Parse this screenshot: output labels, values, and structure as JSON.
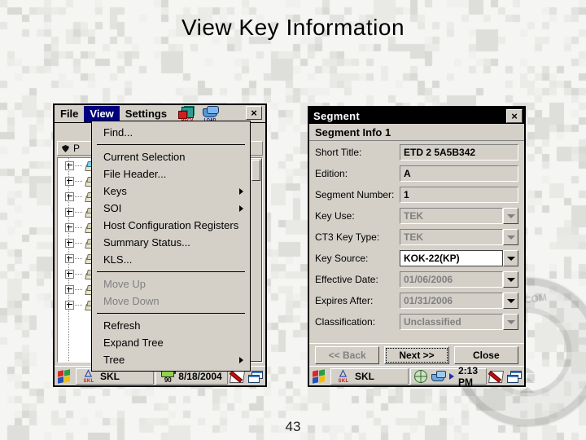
{
  "slide": {
    "title": "View Key Information",
    "page_number": "43",
    "background": "digital-camo-gray",
    "colors": {
      "window_face": "#d4d0c8",
      "titlebar": "#000000",
      "menu_highlight": "#000080",
      "disabled_text": "#808080"
    }
  },
  "left_window": {
    "menubar": {
      "items": [
        {
          "label": "File",
          "active": false
        },
        {
          "label": "View",
          "active": true
        },
        {
          "label": "Settings",
          "active": false
        }
      ],
      "toolbar_icons": [
        {
          "name": "recv-icon",
          "label": "RECV"
        },
        {
          "name": "load-icon",
          "label": "LOAD"
        }
      ],
      "close_label": "×"
    },
    "pathbar": {
      "text": "P"
    },
    "tree": {
      "rows": [
        {
          "expander": "+"
        },
        {
          "expander": "+"
        },
        {
          "expander": "+"
        },
        {
          "expander": "+"
        },
        {
          "expander": "+"
        },
        {
          "expander": "+"
        },
        {
          "expander": "+"
        },
        {
          "expander": "+"
        },
        {
          "expander": "+"
        },
        {
          "expander": "+"
        }
      ]
    },
    "dropdown": {
      "name": "View",
      "items": [
        {
          "label": "Find...",
          "disabled": false,
          "submenu": false
        },
        {
          "separator": true
        },
        {
          "label": "Current Selection",
          "disabled": false,
          "submenu": false
        },
        {
          "label": "File Header...",
          "disabled": false,
          "submenu": false
        },
        {
          "label": "Keys",
          "disabled": false,
          "submenu": true
        },
        {
          "label": "SOI",
          "disabled": false,
          "submenu": true
        },
        {
          "label": "Host Configuration Registers",
          "disabled": false,
          "submenu": false
        },
        {
          "label": "Summary Status...",
          "disabled": false,
          "submenu": false
        },
        {
          "label": "KLS...",
          "disabled": false,
          "submenu": false
        },
        {
          "separator": true
        },
        {
          "label": "Move Up",
          "disabled": true,
          "submenu": false
        },
        {
          "label": "Move Down",
          "disabled": true,
          "submenu": false
        },
        {
          "separator": true
        },
        {
          "label": "Refresh",
          "disabled": false,
          "submenu": false
        },
        {
          "label": "Expand Tree",
          "disabled": false,
          "submenu": false
        },
        {
          "label": "Tree",
          "disabled": false,
          "submenu": true
        }
      ]
    },
    "taskbar": {
      "app_label": "SKL",
      "battery_level": "90",
      "date": "8/18/2004"
    }
  },
  "right_window": {
    "titlebar": {
      "title": "Segment",
      "close_label": "×"
    },
    "header": "Segment Info 1",
    "fields": [
      {
        "label": "Short Title:",
        "value": "ETD 2 5A5B342",
        "type": "text",
        "disabled": false,
        "editable": false
      },
      {
        "label": "Edition:",
        "value": "A",
        "type": "text",
        "disabled": false,
        "editable": true
      },
      {
        "label": "Segment Number:",
        "value": "1",
        "type": "text",
        "disabled": false,
        "editable": true
      },
      {
        "label": "Key Use:",
        "value": "TEK",
        "type": "select",
        "disabled": true,
        "editable": false
      },
      {
        "label": "CT3 Key Type:",
        "value": "TEK",
        "type": "select",
        "disabled": true,
        "editable": false
      },
      {
        "label": "Key Source:",
        "value": "KOK-22(KP)",
        "type": "select",
        "disabled": false,
        "editable": true
      },
      {
        "label": "Effective Date:",
        "value": "01/06/2006",
        "type": "select",
        "disabled": true,
        "editable": false
      },
      {
        "label": "Expires After:",
        "value": "01/31/2006",
        "type": "select",
        "disabled": true,
        "editable": false
      },
      {
        "label": "Classification:",
        "value": "Unclassified",
        "type": "select",
        "disabled": true,
        "editable": false
      }
    ],
    "buttons": [
      {
        "label": "<< Back",
        "disabled": true,
        "default": false
      },
      {
        "label": "Next >>",
        "disabled": false,
        "default": true
      },
      {
        "label": "Close",
        "disabled": false,
        "default": false
      }
    ],
    "taskbar": {
      "app_label": "SKL",
      "time": "2:13 PM"
    }
  }
}
